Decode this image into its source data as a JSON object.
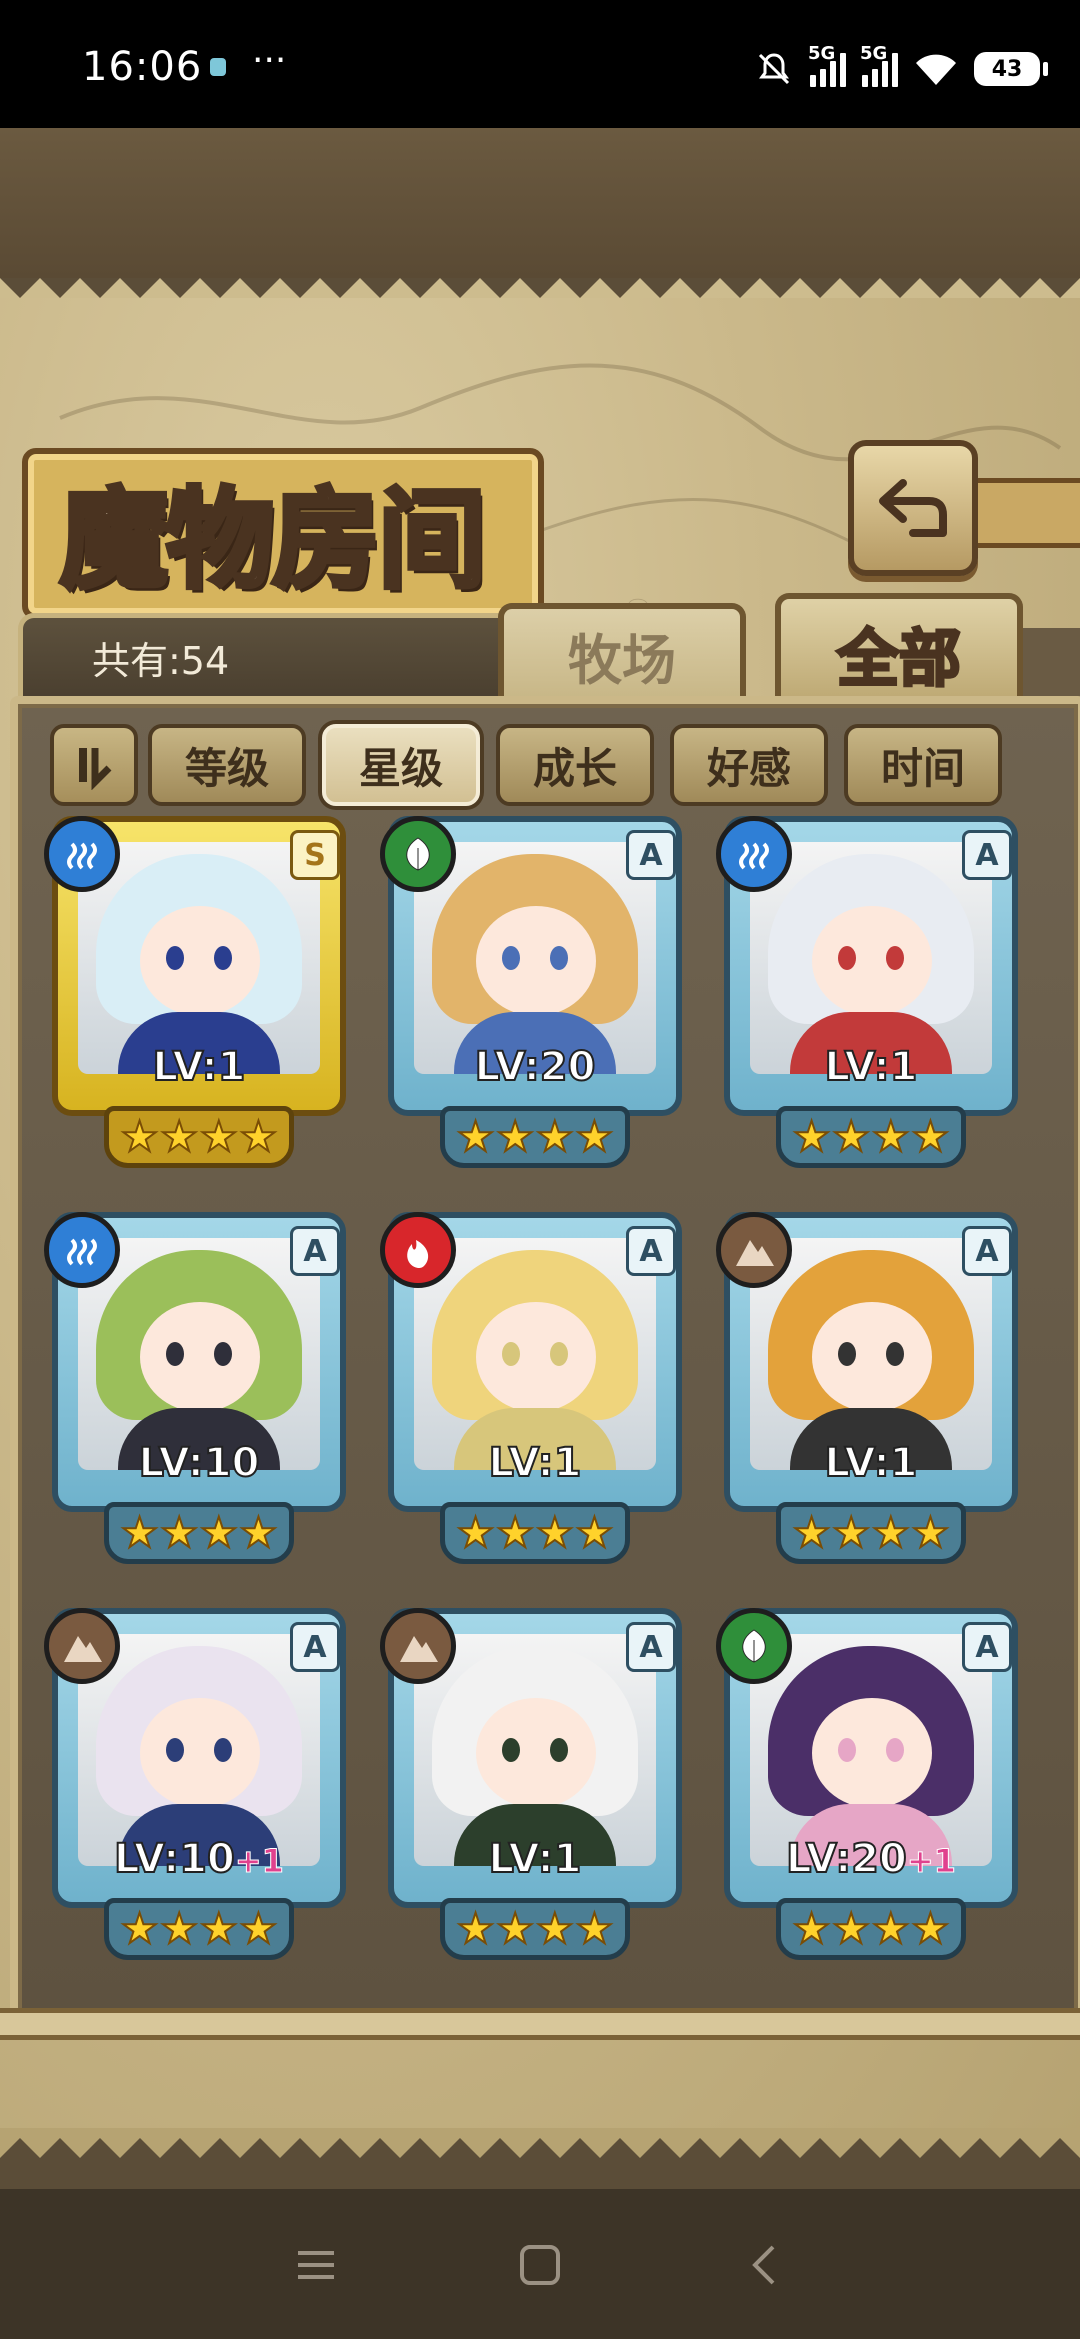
{
  "status_bar": {
    "time": "16:06",
    "dots": "···",
    "network_1": "5G",
    "network_2": "5G",
    "battery": "43"
  },
  "header": {
    "title": "魔物房间",
    "back_icon": "return-arrow-icon"
  },
  "count": "共有:54",
  "tabs": [
    {
      "label": "牧场",
      "active": false
    },
    {
      "label": "全部",
      "active": true
    }
  ],
  "filters": [
    {
      "label": "等级",
      "active": false
    },
    {
      "label": "星级",
      "active": true
    },
    {
      "label": "成长",
      "active": false
    },
    {
      "label": "好感",
      "active": false
    },
    {
      "label": "时间",
      "active": false
    }
  ],
  "cards": [
    {
      "element": "water",
      "rarity": "S",
      "level": "LV:1",
      "bonus": "",
      "stars": 4,
      "frame": "gold",
      "hair": "#d9eef6",
      "accent": "#2a3e8f"
    },
    {
      "element": "grass",
      "rarity": "A",
      "level": "LV:20",
      "bonus": "",
      "stars": 4,
      "frame": "blue",
      "hair": "#e2b46a",
      "accent": "#4b6fb6"
    },
    {
      "element": "water",
      "rarity": "A",
      "level": "LV:1",
      "bonus": "",
      "stars": 4,
      "frame": "blue",
      "hair": "#e8ecf2",
      "accent": "#c23a3a"
    },
    {
      "element": "water",
      "rarity": "A",
      "level": "LV:10",
      "bonus": "",
      "stars": 4,
      "frame": "blue",
      "hair": "#9bbf5a",
      "accent": "#2f2f3a"
    },
    {
      "element": "fire",
      "rarity": "A",
      "level": "LV:1",
      "bonus": "",
      "stars": 4,
      "frame": "blue",
      "hair": "#efd47c",
      "accent": "#d7c67b"
    },
    {
      "element": "earth",
      "rarity": "A",
      "level": "LV:1",
      "bonus": "",
      "stars": 4,
      "frame": "blue",
      "hair": "#e3a23b",
      "accent": "#333333"
    },
    {
      "element": "earth",
      "rarity": "A",
      "level": "LV:10",
      "bonus": "+1",
      "stars": 4,
      "frame": "blue",
      "hair": "#eae3ef",
      "accent": "#2c3e78"
    },
    {
      "element": "earth",
      "rarity": "A",
      "level": "LV:1",
      "bonus": "",
      "stars": 4,
      "frame": "blue",
      "hair": "#f2f2f2",
      "accent": "#2c3f2c"
    },
    {
      "element": "grass",
      "rarity": "A",
      "level": "LV:20",
      "bonus": "+1",
      "stars": 4,
      "frame": "blue",
      "hair": "#4b2f68",
      "accent": "#e6a6c6"
    }
  ],
  "element_colors": {
    "water": "#2f7fd6",
    "grass": "#2f8f3a",
    "fire": "#d8262b",
    "earth": "#7a5a40"
  },
  "nav": {
    "menu_icon": "menu-icon",
    "home_icon": "home-square-icon",
    "back_icon": "back-chevron-icon"
  }
}
